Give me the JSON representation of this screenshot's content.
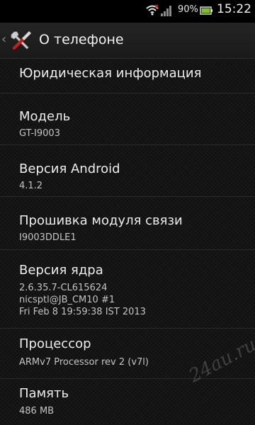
{
  "status_bar": {
    "battery_percent": "90%",
    "battery_level": 0.9,
    "time": "15:22",
    "icons": [
      "wifi-icon",
      "signal-icon",
      "battery-icon"
    ]
  },
  "action_bar": {
    "back_icon": "chevron-left-icon",
    "settings_icon": "tools-icon",
    "title": "О телефоне"
  },
  "items": [
    {
      "title": "Юридическая информация"
    },
    {
      "title": "Модель",
      "value": "GT-I9003"
    },
    {
      "title": "Версия Android",
      "value": "4.1.2"
    },
    {
      "title": "Прошивка модуля связи",
      "value": "I9003DDLE1"
    },
    {
      "title": "Версия ядра",
      "lines": [
        "2.6.35.7-CL615624",
        "nicsptl@JB_CM10 #1",
        "Fri Feb 8 19:59:38 IST 2013"
      ]
    },
    {
      "title": "Процессор",
      "value": "ARMv7 Processor rev 2 (v7l)"
    },
    {
      "title": "Память",
      "value": "486 MB"
    }
  ],
  "watermark": "24au.ru",
  "colors": {
    "background": "#000000",
    "text_primary": "#ededed",
    "text_secondary": "#c4c4c4",
    "battery_green": "#7ec02a",
    "signal_alert": "#e0201c"
  }
}
